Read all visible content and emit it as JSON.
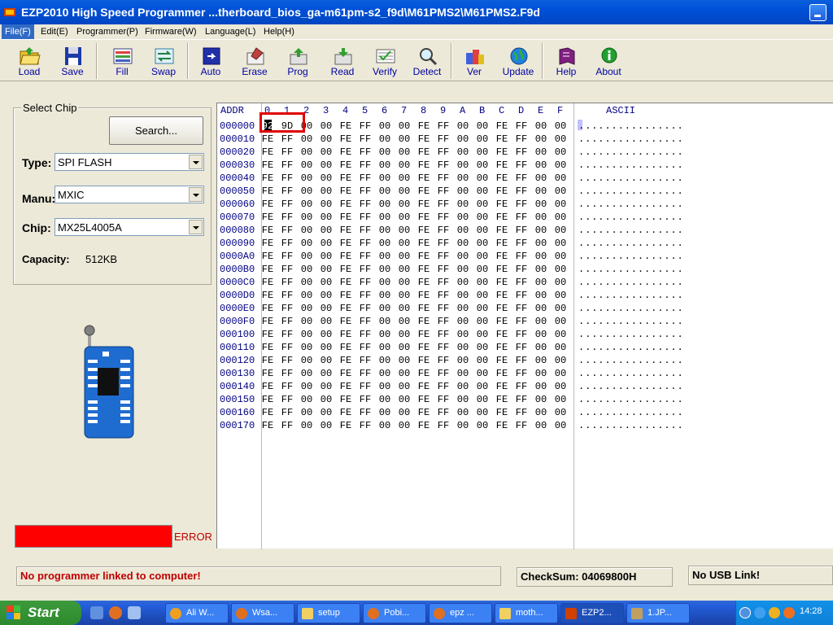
{
  "window": {
    "title": "EZP2010 High Speed Programmer    ...therboard_bios_ga-m61pm-s2_f9d\\M61PMS2\\M61PMS2.F9d"
  },
  "menu": [
    "File(F)",
    "Edit(E)",
    "Programmer(P)",
    "Firmware(W)",
    "Language(L)",
    "Help(H)"
  ],
  "toolbar": [
    {
      "label": "Load",
      "icon": "folder-open-icon"
    },
    {
      "label": "Save",
      "icon": "floppy-disk-icon"
    },
    {
      "label": "Fill",
      "icon": "fill-icon"
    },
    {
      "label": "Swap",
      "icon": "swap-icon"
    },
    {
      "label": "Auto",
      "icon": "auto-icon"
    },
    {
      "label": "Erase",
      "icon": "eraser-icon"
    },
    {
      "label": "Prog",
      "icon": "program-icon"
    },
    {
      "label": "Read",
      "icon": "read-icon"
    },
    {
      "label": "Verify",
      "icon": "verify-icon"
    },
    {
      "label": "Detect",
      "icon": "magnifier-icon"
    },
    {
      "label": "Ver",
      "icon": "version-icon"
    },
    {
      "label": "Update",
      "icon": "globe-icon"
    },
    {
      "label": "Help",
      "icon": "help-book-icon"
    },
    {
      "label": "About",
      "icon": "info-icon"
    }
  ],
  "chip": {
    "group_title": "Select Chip",
    "search_label": "Search...",
    "type_label": "Type:",
    "type_value": "SPI FLASH",
    "manu_label": "Manu:",
    "manu_value": "MXIC",
    "chip_label": "Chip:",
    "chip_value": "MX25L4005A",
    "capacity_label": "Capacity:",
    "capacity_value": "512KB"
  },
  "status_indicator": {
    "label": "ERROR",
    "color": "#ff0000"
  },
  "hex": {
    "addr_header": "ADDR",
    "ascii_header": "ASCII",
    "columns": [
      "0",
      "1",
      "2",
      "3",
      "4",
      "5",
      "6",
      "7",
      "8",
      "9",
      "A",
      "B",
      "C",
      "D",
      "E",
      "F"
    ],
    "first_row": [
      "92",
      "9D",
      "00",
      "00",
      "FE",
      "FF",
      "00",
      "00",
      "FE",
      "FF",
      "00",
      "00",
      "FE",
      "FF",
      "00",
      "00"
    ],
    "pattern": [
      "FE",
      "FF",
      "00",
      "00",
      "FE",
      "FF",
      "00",
      "00",
      "FE",
      "FF",
      "00",
      "00",
      "FE",
      "FF",
      "00",
      "00"
    ],
    "addresses": [
      "000000",
      "000010",
      "000020",
      "000030",
      "000040",
      "000050",
      "000060",
      "000070",
      "000080",
      "000090",
      "0000A0",
      "0000B0",
      "0000C0",
      "0000D0",
      "0000E0",
      "0000F0",
      "000100",
      "000110",
      "000120",
      "000130",
      "000140",
      "000150",
      "000160",
      "000170"
    ],
    "ascii_row": "................"
  },
  "status": {
    "message": "No programmer linked to computer!",
    "checksum": "CheckSum: 04069800H",
    "usb": "No USB Link!"
  },
  "taskbar": {
    "start": "Start",
    "tasks": [
      "Ali W...",
      "Wsa...",
      "setup",
      "Pobi...",
      "epz ...",
      "moth...",
      "EZP2...",
      "1.JP..."
    ],
    "clock": "14:28"
  },
  "colors": {
    "accent": "#316ac5",
    "title_blue": "#0050d8",
    "error_red": "#ff0000",
    "highlight": "#e00000"
  }
}
